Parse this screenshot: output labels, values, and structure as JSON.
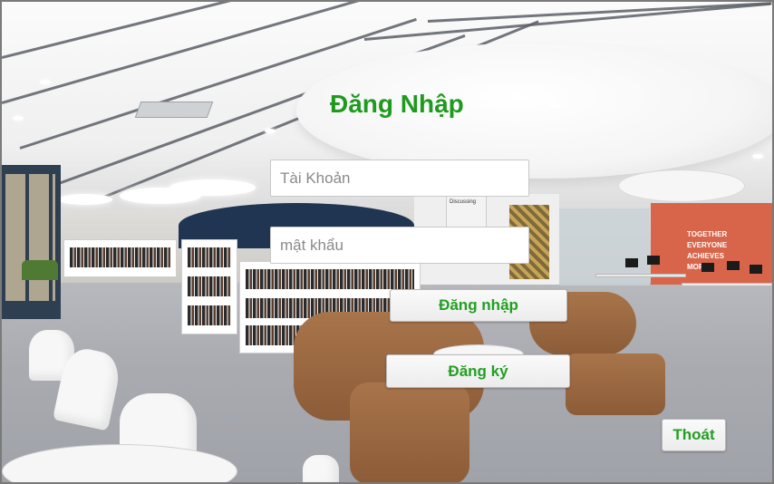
{
  "form": {
    "title": "Đăng Nhập",
    "username": {
      "value": "",
      "placeholder": "Tài Khoản"
    },
    "password": {
      "value": "",
      "placeholder": "mật khẩu"
    },
    "login_label": "Đăng nhập",
    "register_label": "Đăng ký",
    "exit_label": "Thoát"
  },
  "background": {
    "wall_sign": [
      "TOGETHER",
      "EVERYONE",
      "ACHIEVES",
      "MORE"
    ],
    "discussing_label": "Discussing"
  },
  "colors": {
    "accent_green": "#22a022",
    "title_green": "#1f9a1f"
  }
}
